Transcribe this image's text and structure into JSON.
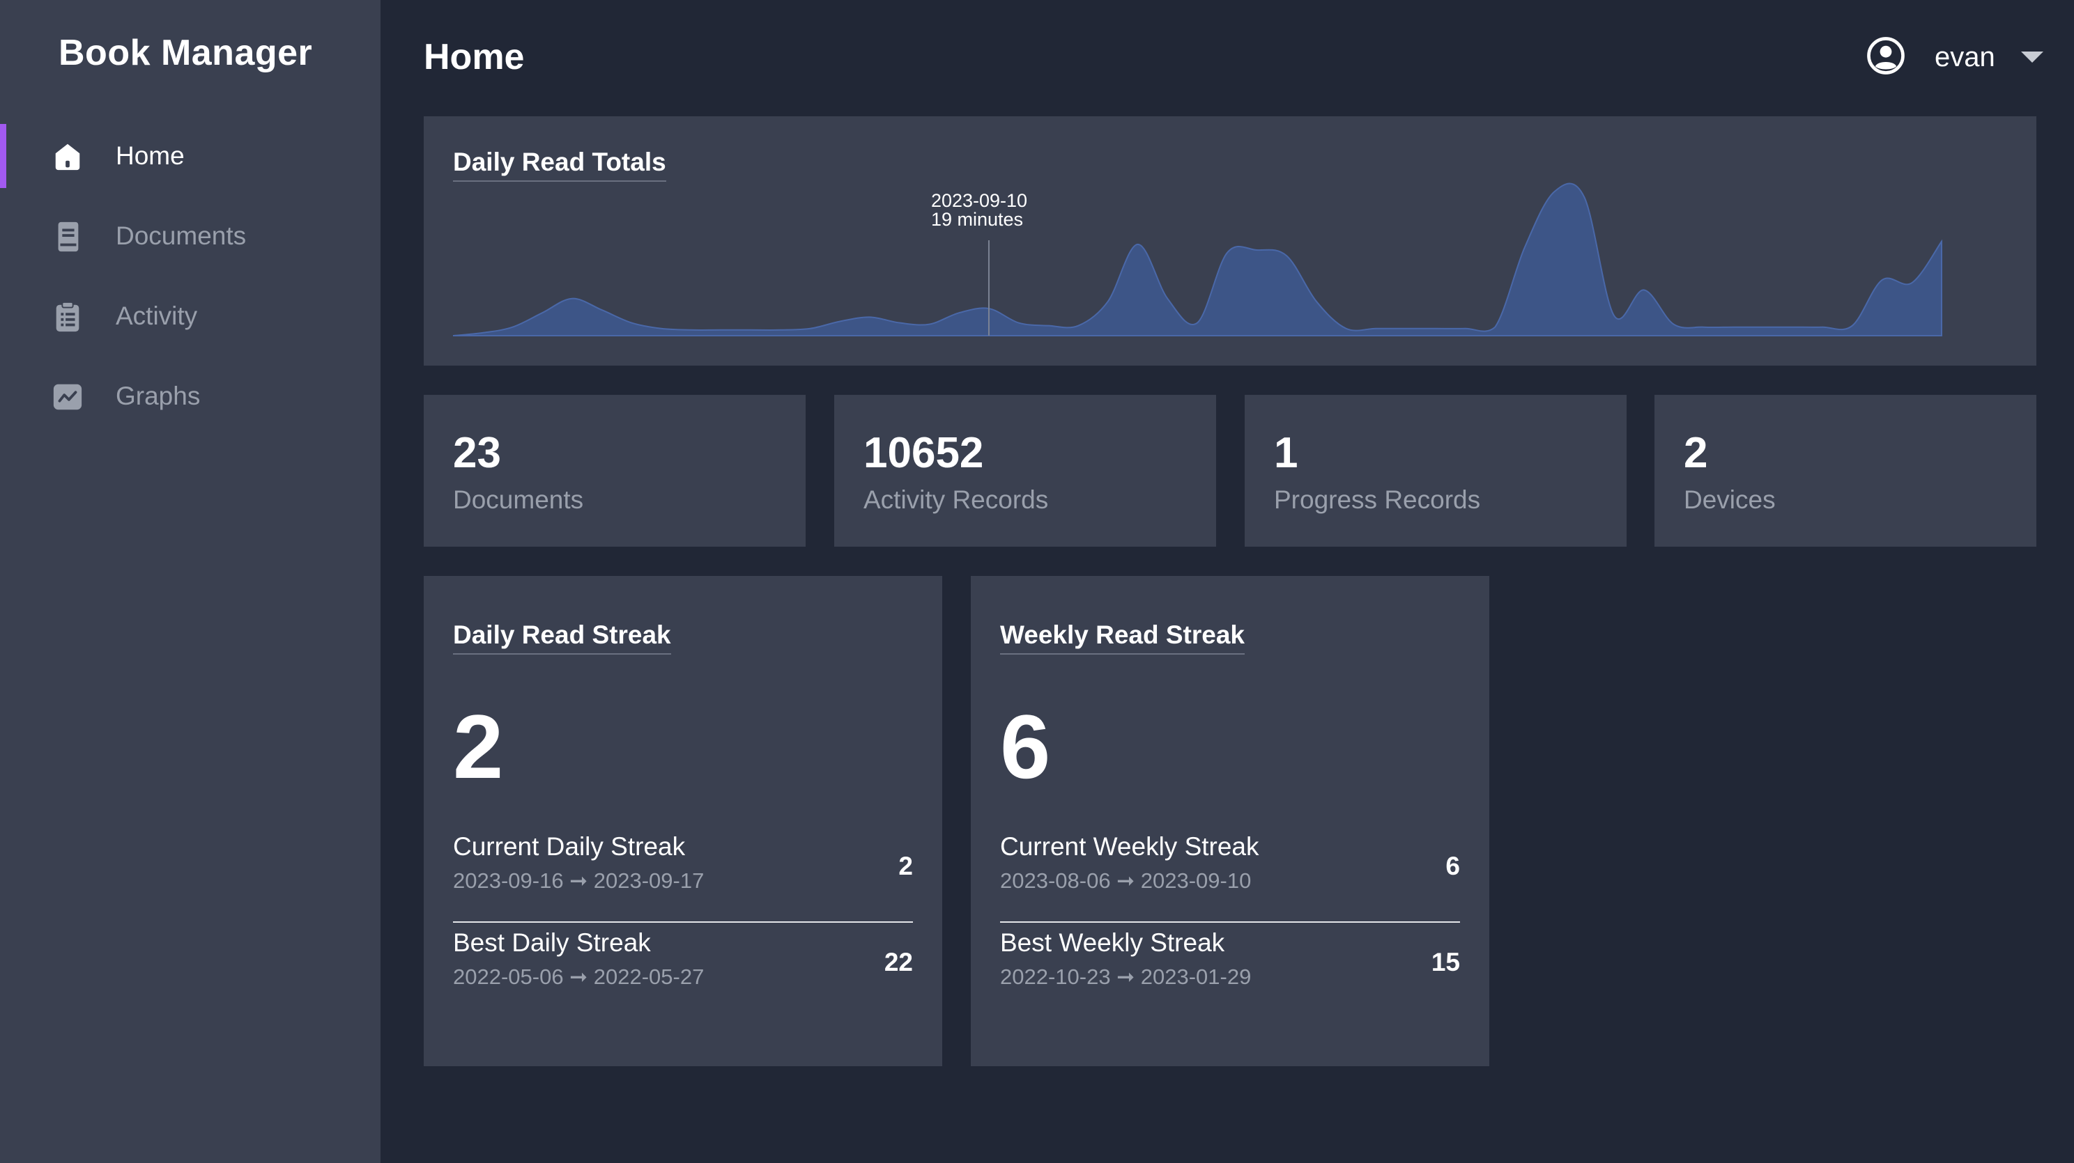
{
  "app": {
    "title": "Book Manager"
  },
  "sidebar": {
    "items": [
      {
        "label": "Home",
        "icon": "home-icon",
        "active": true
      },
      {
        "label": "Documents",
        "icon": "document-icon",
        "active": false
      },
      {
        "label": "Activity",
        "icon": "clipboard-icon",
        "active": false
      },
      {
        "label": "Graphs",
        "icon": "graph-icon",
        "active": false
      }
    ]
  },
  "header": {
    "title": "Home",
    "user": {
      "name": "evan",
      "icon": "user-circle-icon"
    }
  },
  "colors": {
    "accent": "#a25af0",
    "background": "#212736",
    "panel": "#3a4050",
    "chart_fill": "#3d5587",
    "chart_stroke": "#4a68a8"
  },
  "daily_chart": {
    "title": "Daily Read Totals",
    "tooltip": {
      "date": "2023-09-10",
      "value": "19 minutes"
    }
  },
  "chart_data": {
    "type": "area",
    "title": "Daily Read Totals",
    "xlabel": "",
    "ylabel": "",
    "grid": false,
    "highlight": {
      "date": "2023-09-10",
      "minutes": 19
    },
    "values": [
      0,
      2,
      6,
      16,
      26,
      18,
      9,
      5,
      4,
      4,
      4,
      4,
      5,
      10,
      13,
      9,
      8,
      16,
      19,
      9,
      7,
      7,
      24,
      64,
      26,
      9,
      58,
      60,
      56,
      24,
      5,
      5,
      5,
      5,
      5,
      6,
      62,
      101,
      97,
      14,
      32,
      8,
      6,
      6,
      6,
      6,
      6,
      7,
      39,
      37,
      66
    ]
  },
  "stats": [
    {
      "value": "23",
      "label": "Documents"
    },
    {
      "value": "10652",
      "label": "Activity Records"
    },
    {
      "value": "1",
      "label": "Progress Records"
    },
    {
      "value": "2",
      "label": "Devices"
    }
  ],
  "streaks": [
    {
      "title": "Daily Read Streak",
      "big": "2",
      "current": {
        "label": "Current Daily Streak",
        "dates": "2023-09-16 ➞ 2023-09-17",
        "value": "2"
      },
      "best": {
        "label": "Best Daily Streak",
        "dates": "2022-05-06 ➞ 2022-05-27",
        "value": "22"
      }
    },
    {
      "title": "Weekly Read Streak",
      "big": "6",
      "current": {
        "label": "Current Weekly Streak",
        "dates": "2023-08-06 ➞ 2023-09-10",
        "value": "6"
      },
      "best": {
        "label": "Best Weekly Streak",
        "dates": "2022-10-23 ➞ 2023-01-29",
        "value": "15"
      }
    }
  ]
}
